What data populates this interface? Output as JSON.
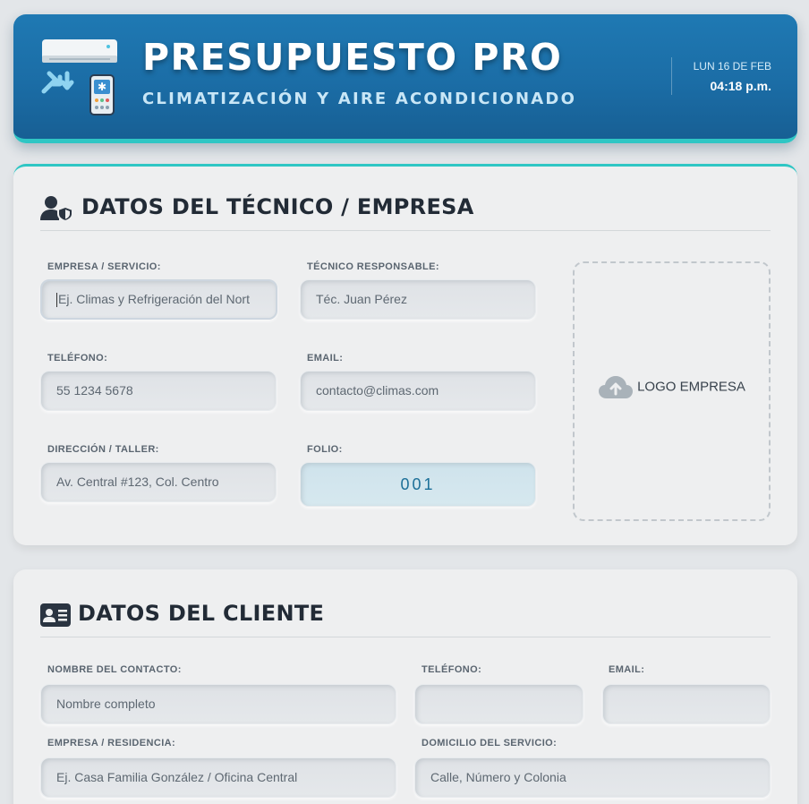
{
  "header": {
    "title": "PRESUPUESTO PRO",
    "subtitle": "CLIMATIZACIÓN Y AIRE ACONDICIONADO",
    "date": "LUN 16 DE FEB",
    "time": "04:18 p.m."
  },
  "tech_section": {
    "title": "DATOS DEL TÉCNICO / EMPRESA",
    "empresa_label": "EMPRESA / SERVICIO:",
    "empresa_placeholder": "Ej. Climas y Refrigeración del Nort",
    "tecnico_label": "TÉCNICO RESPONSABLE:",
    "tecnico_placeholder": "Téc. Juan Pérez",
    "telefono_label": "TELÉFONO:",
    "telefono_placeholder": "55 1234 5678",
    "email_label": "EMAIL:",
    "email_placeholder": "contacto@climas.com",
    "direccion_label": "DIRECCIÓN / TALLER:",
    "direccion_placeholder": "Av. Central #123, Col. Centro",
    "folio_label": "FOLIO:",
    "folio_value": "001",
    "logo_label": "LOGO EMPRESA"
  },
  "client_section": {
    "title": "DATOS DEL CLIENTE",
    "nombre_label": "NOMBRE DEL CONTACTO:",
    "nombre_placeholder": "Nombre completo",
    "telefono_label": "TELÉFONO:",
    "telefono_value": "",
    "email_label": "EMAIL:",
    "email_value": "",
    "empresa_label": "EMPRESA / RESIDENCIA:",
    "empresa_placeholder": "Ej. Casa Familia González / Oficina Central",
    "domicilio_label": "DOMICILIO DEL SERVICIO:",
    "domicilio_placeholder": "Calle, Número y Colonia"
  },
  "icons": {
    "header_logo": "air-conditioner-icon",
    "tech_section": "user-shield-icon",
    "client_section": "id-card-icon",
    "logo_upload": "cloud-upload-icon"
  },
  "colors": {
    "header_blue": "#1b6da6",
    "accent_teal": "#2fc6c4",
    "folio_text": "#1c6f98"
  }
}
